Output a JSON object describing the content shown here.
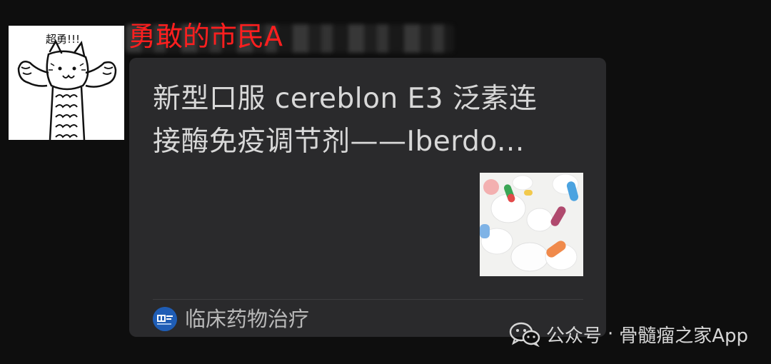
{
  "sender": {
    "name": "勇敢的市民A"
  },
  "avatar": {
    "caption": "超勇!!!"
  },
  "card": {
    "title_line1": "新型口服 cereblon E3 泛素连",
    "title_line2": "接酶免疫调节剂——Iberdo...",
    "source_name": "临床药物治疗"
  },
  "watermark": {
    "prefix": "公众号",
    "separator": "·",
    "account": "骨髓瘤之家App"
  },
  "colors": {
    "sender_name": "#ff1f1f",
    "card_bg": "#2a2a2c",
    "page_bg": "#0e0e0e",
    "source_logo": "#1f5db5"
  },
  "icons": {
    "avatar": "cat-flexing-drawing",
    "thumbnail": "pills-photo",
    "source_logo": "journal-logo-icon",
    "watermark": "wechat-icon"
  }
}
